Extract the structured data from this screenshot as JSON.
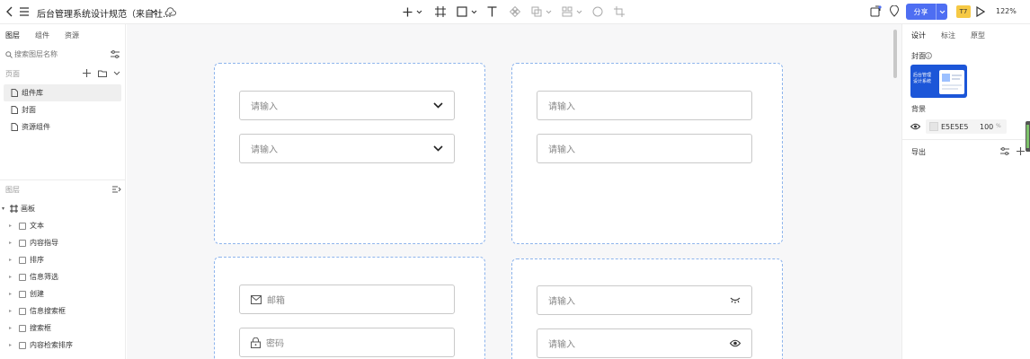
{
  "topbar": {
    "title": "后台管理系统设计规范（来自社...",
    "share_label": "分享",
    "badge": "T7",
    "zoom": "122%"
  },
  "left": {
    "tabs": [
      "图层",
      "组件",
      "资源"
    ],
    "search_placeholder": "搜索图层名称",
    "pages_header": "页面",
    "pages": [
      "组件库",
      "封面",
      "资源组件"
    ],
    "layers_header": "图层",
    "root_layer": "画板",
    "layers": [
      "文本",
      "内容指导",
      "排序",
      "信息筛选",
      "创建",
      "信息搜索框",
      "搜索框",
      "内容检索排序"
    ]
  },
  "canvas": {
    "frame1": {
      "field1": "请输入",
      "field2": "请输入"
    },
    "frame2": {
      "field1": "请输入",
      "field2": "请输入"
    },
    "frame3": {
      "email": "邮箱",
      "password": "密码"
    },
    "frame4": {
      "field1": "请输入",
      "field2": "请输入"
    }
  },
  "right": {
    "tabs": [
      "设计",
      "标注",
      "原型"
    ],
    "cover_label": "封面",
    "cover_text": "后台管理\n设计系统",
    "background_label": "背景",
    "bg_color": "E5E5E5",
    "bg_opacity": "100",
    "percent": "%",
    "export_label": "导出"
  },
  "colors": {
    "accent": "#4e6ef2",
    "frame_border": "#8db4ec",
    "badge": "#f6c944"
  }
}
